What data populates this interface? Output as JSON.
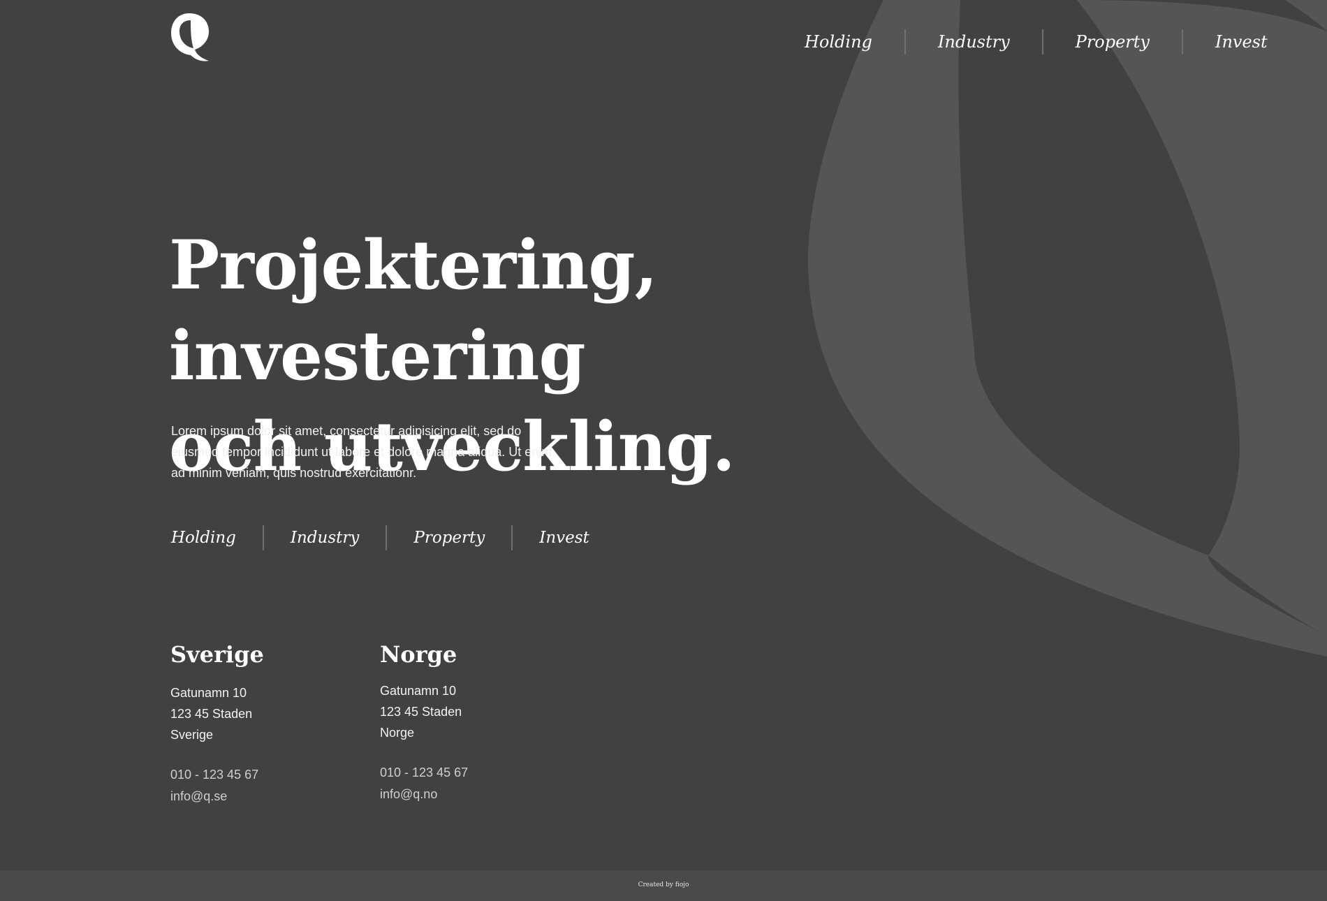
{
  "colors": {
    "background": "#414141",
    "shape": "#555555",
    "text": "#ffffff",
    "divider": "#6f6f6f",
    "footer_bg": "#4a4a4a"
  },
  "header": {
    "logo_icon": "q-logo-icon",
    "nav": [
      "Holding",
      "Industry",
      "Property",
      "Invest"
    ]
  },
  "hero": {
    "title_line1": "Projektering, investering",
    "title_line2": "och utveckling.",
    "intro": "Lorem ipsum dolor sit amet, consectetur adipisicing elit, sed do eiusmod tempor incididunt ut labore et dolore magna aliqua. Ut enim ad minim veniam, quis nostrud exercitationr."
  },
  "subnav": [
    "Holding",
    "Industry",
    "Property",
    "Invest"
  ],
  "offices": [
    {
      "country": "Sverige",
      "street": "Gatunamn 10",
      "city": "123 45 Staden",
      "region": "Sverige",
      "phone": "010 - 123 45 67",
      "email": "info@q.se"
    },
    {
      "country": "Norge",
      "street": "Gatunamn 10",
      "city": "123 45 Staden",
      "region": "Norge",
      "phone": "010 - 123 45 67",
      "email": "info@q.no"
    }
  ],
  "footer": {
    "credit": "Created by fiojo"
  }
}
